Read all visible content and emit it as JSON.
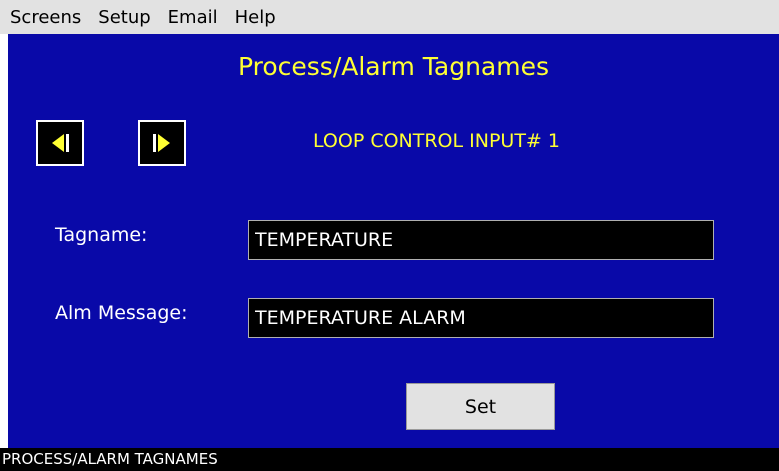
{
  "menubar": {
    "items": [
      {
        "label": "Screens"
      },
      {
        "label": "Setup"
      },
      {
        "label": "Email"
      },
      {
        "label": "Help"
      }
    ]
  },
  "panel": {
    "title": "Process/Alarm Tagnames",
    "loop_label": "LOOP CONTROL INPUT# 1",
    "nav": {
      "prev_icon": "previous-arrow-icon",
      "next_icon": "next-arrow-icon"
    },
    "tagname": {
      "label": "Tagname:",
      "value": "TEMPERATURE"
    },
    "alarm_message": {
      "label": "Alm Message:",
      "value": "TEMPERATURE ALARM"
    },
    "set_label": "Set"
  },
  "status_bar": {
    "text": "PROCESS/ALARM TAGNAMES"
  },
  "colors": {
    "panel_background": "#0909a8",
    "title_text": "#ffff33",
    "menubar_background": "#e2e2e2",
    "input_background": "#000000",
    "status_background": "#000000"
  }
}
